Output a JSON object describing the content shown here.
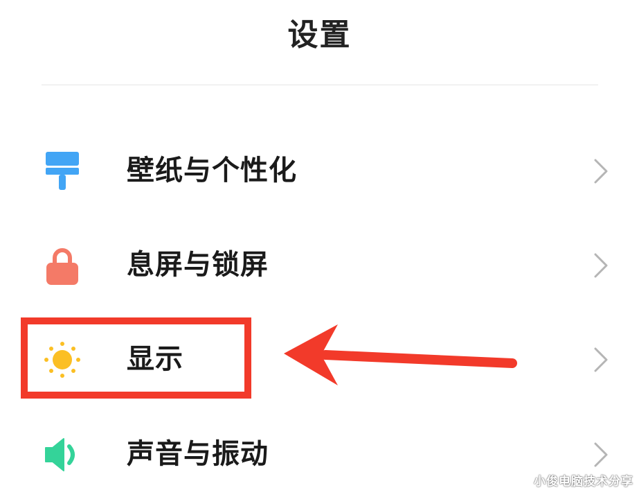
{
  "header": {
    "title": "设置"
  },
  "items": [
    {
      "label": "壁纸与个性化",
      "icon": "paintbrush-icon",
      "color": "#42a5f5"
    },
    {
      "label": "息屏与锁屏",
      "icon": "lock-icon",
      "color": "#f47a67"
    },
    {
      "label": "显示",
      "icon": "sun-icon",
      "color": "#fbbf24"
    },
    {
      "label": "声音与振动",
      "icon": "speaker-icon",
      "color": "#34d399"
    }
  ],
  "annotation": {
    "highlight_color": "#f23a2a",
    "target": "显示"
  },
  "watermark": {
    "text": "小俊电脑技术分享"
  }
}
